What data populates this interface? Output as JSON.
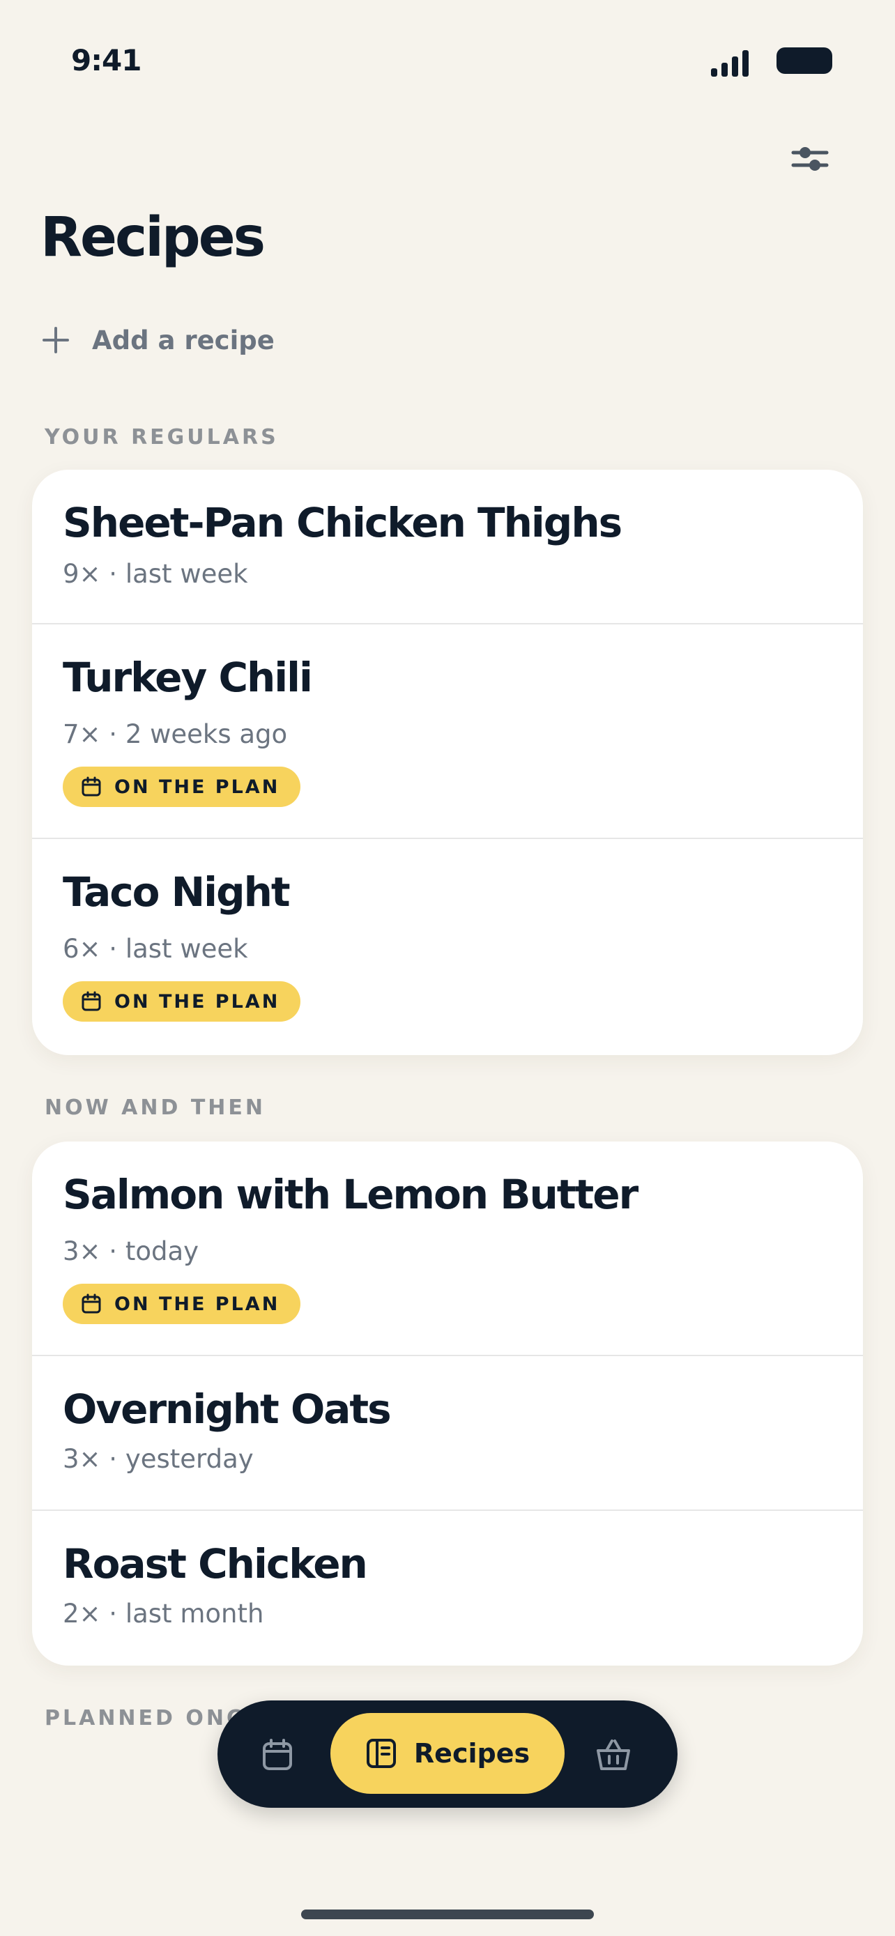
{
  "status_bar": {
    "time": "9:41"
  },
  "header": {
    "title": "Recipes",
    "add_label": "Add a recipe"
  },
  "sections": {
    "regulars": {
      "title": "YOUR REGULARS",
      "recipes": [
        {
          "name": "Sheet-Pan Chicken Thighs",
          "meta": "9× · last week",
          "badge": ""
        },
        {
          "name": "Turkey Chili",
          "meta": "7× · 2 weeks ago",
          "badge": "ON THE PLAN"
        },
        {
          "name": "Taco Night",
          "meta": "6× · last week",
          "badge": "ON THE PLAN"
        }
      ]
    },
    "now_and_then": {
      "title": "NOW AND THEN",
      "recipes": [
        {
          "name": "Salmon with Lemon Butter",
          "meta": "3× · today",
          "badge": "ON THE PLAN"
        },
        {
          "name": "Overnight Oats",
          "meta": "3× · yesterday",
          "badge": ""
        },
        {
          "name": "Roast Chicken",
          "meta": "2× · last month",
          "badge": ""
        }
      ]
    },
    "planned_once": {
      "title": "PLANNED ONCE"
    }
  },
  "tab_bar": {
    "tabs": [
      {
        "icon": "calendar-icon",
        "label": ""
      },
      {
        "icon": "book-icon",
        "label": "Recipes",
        "active": true
      },
      {
        "icon": "basket-icon",
        "label": ""
      }
    ]
  },
  "colors": {
    "background": "#f6f3ec",
    "accent": "#f7d35d",
    "ink": "#0f1b2a",
    "muted": "#6b7480"
  }
}
